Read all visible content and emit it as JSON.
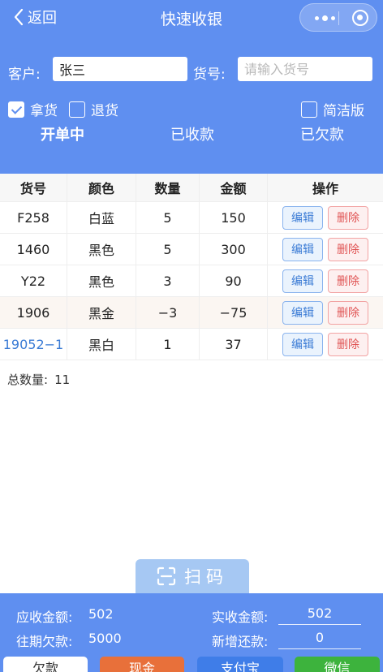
{
  "nav": {
    "back_label": "返回",
    "title": "快速收银"
  },
  "form": {
    "customer_label": "客户:",
    "customer_value": "张三",
    "sku_label": "货号:",
    "sku_placeholder": "请输入货号"
  },
  "options": {
    "take_label": "拿货",
    "take_checked": true,
    "return_label": "退货",
    "return_checked": false,
    "simple_label": "简洁版",
    "simple_checked": false
  },
  "tabs": [
    "开单中",
    "已收款",
    "已欠款"
  ],
  "table": {
    "headers": [
      "货号",
      "颜色",
      "数量",
      "金额",
      "操作"
    ],
    "edit_label": "编辑",
    "delete_label": "删除",
    "rows": [
      {
        "sku": "F258",
        "color": "白蓝",
        "qty": "5",
        "amount": "150"
      },
      {
        "sku": "1460",
        "color": "黑色",
        "qty": "5",
        "amount": "300"
      },
      {
        "sku": "Y22",
        "color": "黑色",
        "qty": "3",
        "amount": "90"
      },
      {
        "sku": "1906",
        "color": "黑金",
        "qty": "−3",
        "amount": "−75"
      },
      {
        "sku": "19052−1",
        "color": "黑白",
        "qty": "1",
        "amount": "37"
      }
    ]
  },
  "summary": {
    "total_qty_label": "总数量:",
    "total_qty": "11"
  },
  "scan_label": "扫码",
  "footer": {
    "receivable_label": "应收金额:",
    "receivable": "502",
    "prev_debt_label": "往期欠款:",
    "prev_debt": "5000",
    "received_label": "实收金额:",
    "received": "502",
    "new_repay_label": "新增还款:",
    "new_repay": "0",
    "pay_buttons": [
      "欠款",
      "现金",
      "支付宝",
      "微信"
    ]
  },
  "colors": {
    "primary": "#5f8ff0",
    "pay_credit": "#ffffff",
    "pay_cash": "#e8703a",
    "pay_alipay": "#3f7de8",
    "pay_wechat": "#3db33d"
  }
}
